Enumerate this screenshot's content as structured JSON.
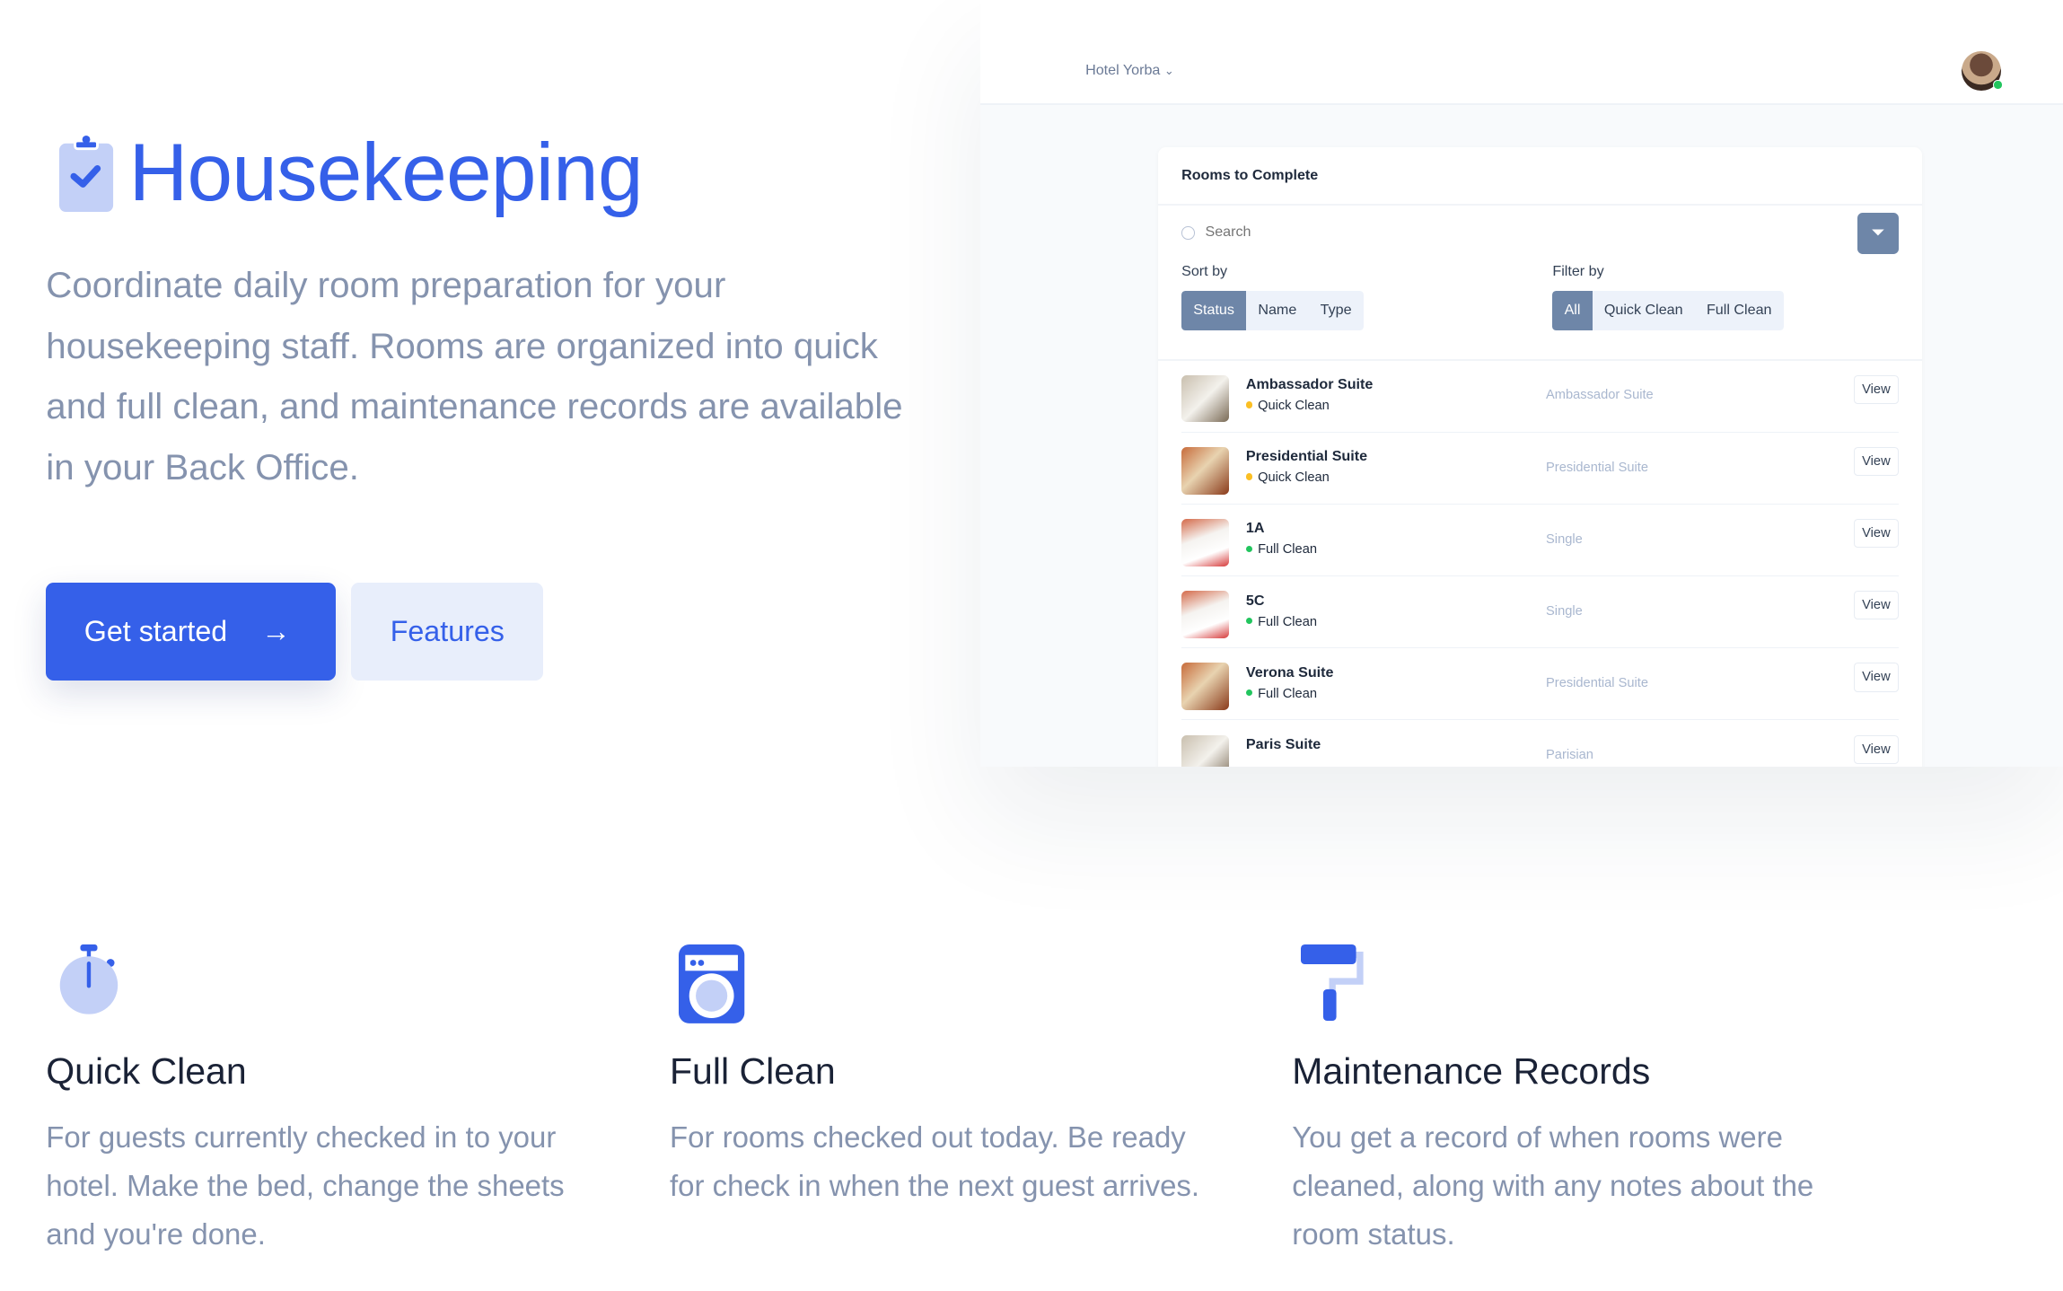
{
  "hero": {
    "title": "Housekeeping",
    "icon": "clipboard-check-icon",
    "description": "Coordinate daily room preparation for your housekeeping staff. Rooms are organized into quick and full clean, and maintenance records are available in your Back Office.",
    "primary_button": "Get started",
    "secondary_button": "Features",
    "accent": "#3560e9"
  },
  "app": {
    "hotel_selector": "Hotel Yorba",
    "card_title": "Rooms to Complete",
    "search_placeholder": "Search",
    "sort_label": "Sort by",
    "sort_options": [
      "Status",
      "Name",
      "Type"
    ],
    "sort_selected": "Status",
    "filter_label": "Filter by",
    "filter_options": [
      "All",
      "Quick Clean",
      "Full Clean"
    ],
    "filter_selected": "All",
    "rooms": [
      {
        "name": "Ambassador Suite",
        "status": "Quick Clean",
        "type": "Ambassador Suite",
        "action": "View"
      },
      {
        "name": "Presidential Suite",
        "status": "Quick Clean",
        "type": "Presidential Suite",
        "action": "View"
      },
      {
        "name": "1A",
        "status": "Full Clean",
        "type": "Single",
        "action": "View"
      },
      {
        "name": "5C",
        "status": "Full Clean",
        "type": "Single",
        "action": "View"
      },
      {
        "name": "Verona Suite",
        "status": "Full Clean",
        "type": "Presidential Suite",
        "action": "View"
      },
      {
        "name": "Paris Suite",
        "status": "",
        "type": "Parisian",
        "action": "View"
      }
    ],
    "status_colors": {
      "Quick Clean": "#fbbf24",
      "Full Clean": "#22c55e"
    }
  },
  "features": [
    {
      "title": "Quick Clean",
      "icon": "stopwatch-icon",
      "description": "For guests currently checked in to your hotel. Make the bed, change the sheets and you're done."
    },
    {
      "title": "Full Clean",
      "icon": "washing-machine-icon",
      "description": "For rooms checked out today. Be ready for check in when the next guest arrives."
    },
    {
      "title": "Maintenance Records",
      "icon": "paint-roller-icon",
      "description": "You get a record of when rooms were cleaned, along with any notes about the room status."
    }
  ]
}
